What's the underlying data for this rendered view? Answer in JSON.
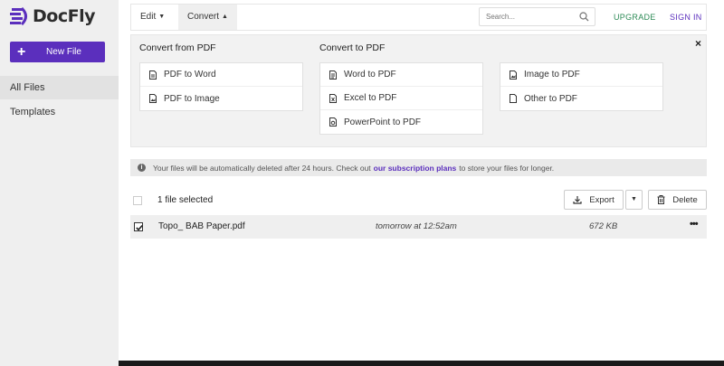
{
  "app": {
    "brand": "DocFly",
    "brand_color": "#5b2fbd",
    "upgrade_color": "#2e8b57"
  },
  "sidebar": {
    "new_file_label": "New File",
    "new_file_icon": "plus-icon",
    "items": [
      {
        "label": "All Files",
        "active": true
      },
      {
        "label": "Templates",
        "active": false
      }
    ]
  },
  "topbar": {
    "edit_label": "Edit",
    "convert_label": "Convert",
    "search_placeholder": "Search...",
    "search_icon": "search-icon",
    "upgrade_label": "UPGRADE",
    "signin_label": "SIGN IN"
  },
  "convert_menu": {
    "from_pdf_heading": "Convert from PDF",
    "to_pdf_heading": "Convert to PDF",
    "close_label": "×",
    "from_pdf": [
      {
        "label": "PDF to Word"
      },
      {
        "label": "PDF to Image"
      }
    ],
    "to_pdf_col1": [
      {
        "label": "Word to PDF"
      },
      {
        "label": "Excel to PDF"
      },
      {
        "label": "PowerPoint to PDF"
      }
    ],
    "to_pdf_col2": [
      {
        "label": "Image to PDF"
      },
      {
        "label": "Other to PDF"
      }
    ]
  },
  "notice": {
    "text_before": "Your files will be automatically deleted after 24 hours. Check out",
    "link": "our subscription plans",
    "text_after": "to store your files for longer."
  },
  "toolbar": {
    "selection_text": "1 file selected",
    "export_label": "Export",
    "delete_label": "Delete"
  },
  "files": [
    {
      "name": "Topo_ BAB Paper.pdf",
      "date": "tomorrow at 12:52am",
      "size": "672 KB",
      "checked": true,
      "more": "•••"
    }
  ]
}
